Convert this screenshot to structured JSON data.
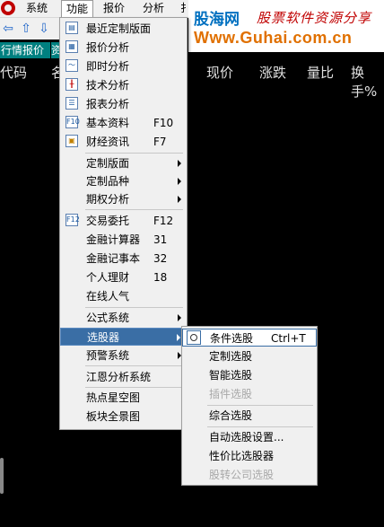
{
  "menubar": {
    "items": [
      "系统",
      "功能",
      "报价",
      "分析",
      "扌"
    ]
  },
  "watermark": {
    "brand": "股海网",
    "slogan": "股票软件资源分享",
    "url": "Www.Guhai.com.cn"
  },
  "toolbar": {
    "arrows": [
      "⇦",
      "⇧",
      "⇩"
    ]
  },
  "tabs": {
    "quote": "行情报价",
    "partial": "资"
  },
  "columns": [
    "代码",
    "名",
    "现价",
    "涨跌",
    "量比",
    "换手%"
  ],
  "function_menu": {
    "items": [
      {
        "label": "最近定制版面",
        "icon": "layout-icon"
      },
      {
        "label": "报价分析",
        "icon": "grid-icon"
      },
      {
        "label": "即时分析",
        "icon": "line-chart-icon"
      },
      {
        "label": "技术分析",
        "icon": "candlestick-icon"
      },
      {
        "label": "报表分析",
        "icon": "report-icon"
      },
      {
        "label": "基本资料",
        "shortcut": "F10",
        "icon": "f10-icon"
      },
      {
        "label": "财经资讯",
        "shortcut": "F7",
        "icon": "news-icon"
      },
      {
        "label": "定制版面"
      },
      {
        "label": "定制品种"
      },
      {
        "label": "期权分析"
      },
      {
        "label": "交易委托",
        "shortcut": "F12",
        "icon": "f12-icon"
      },
      {
        "label": "金融计算器",
        "shortcut": "31"
      },
      {
        "label": "金融记事本",
        "shortcut": "32"
      },
      {
        "label": "个人理财",
        "shortcut": "18"
      },
      {
        "label": "在线人气"
      },
      {
        "label": "公式系统"
      },
      {
        "label": "选股器"
      },
      {
        "label": "预警系统"
      },
      {
        "label": "江恩分析系统"
      },
      {
        "label": "热点星空图"
      },
      {
        "label": "板块全景图"
      }
    ]
  },
  "stock_picker_menu": {
    "items": [
      {
        "label": "条件选股",
        "shortcut": "Ctrl+T"
      },
      {
        "label": "定制选股"
      },
      {
        "label": "智能选股"
      },
      {
        "label": "插件选股",
        "disabled": true
      },
      {
        "label": "综合选股"
      },
      {
        "label": "自动选股设置..."
      },
      {
        "label": "性价比选股器"
      },
      {
        "label": "股转公司选股",
        "disabled": true
      }
    ]
  },
  "colors": {
    "menu_highlight": "#3a6ea5",
    "tab_bg": "#008080",
    "watermark_blue": "#0070c0",
    "watermark_red": "#c00000",
    "watermark_orange": "#e07000"
  }
}
